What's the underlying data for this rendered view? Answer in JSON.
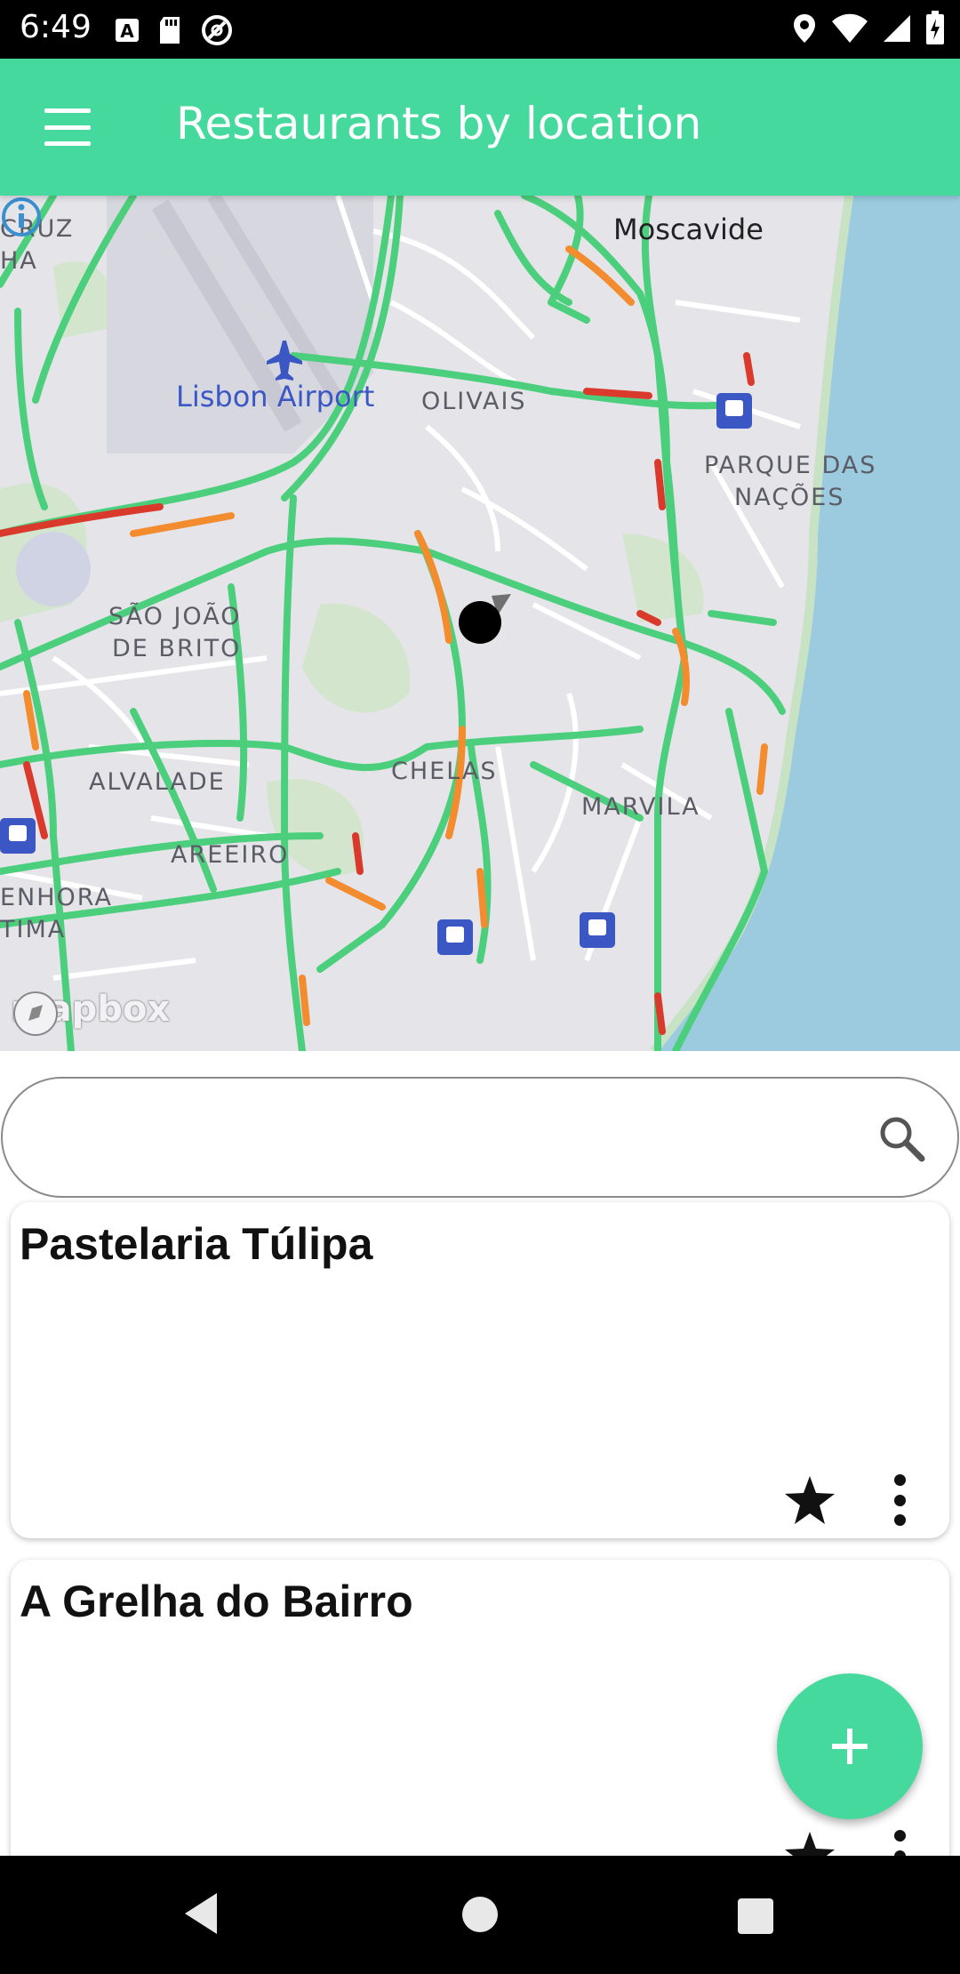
{
  "status_bar": {
    "time": "6:49",
    "left_icons": [
      "text-a-icon",
      "sd-card-icon",
      "at-sign-icon"
    ],
    "right_icons": [
      "location-pin-icon",
      "wifi-icon",
      "cell-signal-icon",
      "battery-charging-icon"
    ]
  },
  "app_bar": {
    "menu_icon": "hamburger-menu-icon",
    "title": "Restaurants by location",
    "color": "#45d99d"
  },
  "map": {
    "labels": [
      {
        "text": "Moscavide",
        "kind": "city"
      },
      {
        "text": "CRUZ",
        "kind": "district"
      },
      {
        "text": "HA",
        "kind": "district"
      },
      {
        "text": "Lisbon Airport",
        "kind": "poi"
      },
      {
        "text": "OLIVAIS",
        "kind": "district"
      },
      {
        "text": "PARQUE DAS",
        "kind": "district"
      },
      {
        "text": "NAÇÕES",
        "kind": "district"
      },
      {
        "text": "SÃO JOÃO",
        "kind": "district"
      },
      {
        "text": "DE BRITO",
        "kind": "district"
      },
      {
        "text": "ALVALADE",
        "kind": "district"
      },
      {
        "text": "CHELAS",
        "kind": "district"
      },
      {
        "text": "MARVILA",
        "kind": "district"
      },
      {
        "text": "AREEIRO",
        "kind": "district"
      },
      {
        "text": "ENHORA",
        "kind": "district"
      },
      {
        "text": "TIMA",
        "kind": "district"
      }
    ],
    "attribution": "mapbox",
    "water_color": "#9ccbe0",
    "road_color": "#4ccf7d",
    "congestion_color": "#f28c2e",
    "heavy_congestion_color": "#d93a2b"
  },
  "search": {
    "value": "",
    "placeholder": "",
    "icon": "search-icon"
  },
  "restaurants": [
    {
      "name": "Pastelaria Túlipa",
      "favorite": true
    },
    {
      "name": "A Grelha do Bairro",
      "favorite": true
    }
  ],
  "fab": {
    "icon": "plus-icon",
    "color": "#45d99d"
  },
  "nav_bar": {
    "buttons": [
      "back-icon",
      "home-icon",
      "recents-icon"
    ]
  }
}
